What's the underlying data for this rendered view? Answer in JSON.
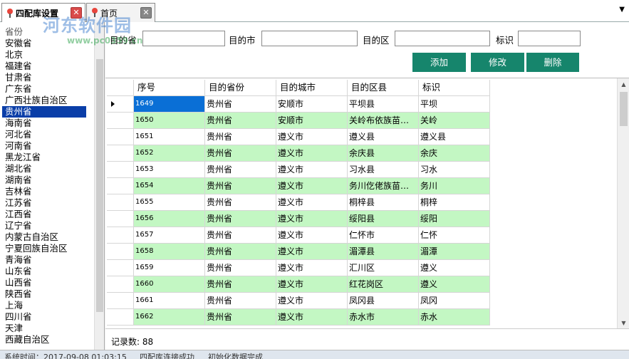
{
  "tabs": [
    {
      "label": "四配库设置",
      "active": true
    },
    {
      "label": "首页",
      "active": false
    }
  ],
  "watermark": {
    "title": "河东软件园",
    "url": "www.pc0359.cn"
  },
  "provinces": {
    "header": "省份",
    "selected": "贵州省",
    "items": [
      "安徽省",
      "北京",
      "福建省",
      "甘肃省",
      "广东省",
      "广西壮族自治区",
      "贵州省",
      "海南省",
      "河北省",
      "河南省",
      "黑龙江省",
      "湖北省",
      "湖南省",
      "吉林省",
      "江苏省",
      "江西省",
      "辽宁省",
      "内蒙古自治区",
      "宁夏回族自治区",
      "青海省",
      "山东省",
      "山西省",
      "陕西省",
      "上海",
      "四川省",
      "天津",
      "西藏自治区"
    ]
  },
  "filters": {
    "province_label": "目的省",
    "city_label": "目的市",
    "district_label": "目的区",
    "tag_label": "标识",
    "province_value": "",
    "city_value": "",
    "district_value": "",
    "tag_value": ""
  },
  "buttons": {
    "add": "添加",
    "edit": "修改",
    "delete": "删除"
  },
  "grid": {
    "columns": [
      "序号",
      "目的省份",
      "目的城市",
      "目的区县",
      "标识"
    ],
    "rows": [
      [
        "1649",
        "贵州省",
        "安顺市",
        "平坝县",
        "平坝"
      ],
      [
        "1650",
        "贵州省",
        "安顺市",
        "关岭布依族苗…",
        "关岭"
      ],
      [
        "1651",
        "贵州省",
        "遵义市",
        "遵义县",
        "遵义县"
      ],
      [
        "1652",
        "贵州省",
        "遵义市",
        "余庆县",
        "余庆"
      ],
      [
        "1653",
        "贵州省",
        "遵义市",
        "习水县",
        "习水"
      ],
      [
        "1654",
        "贵州省",
        "遵义市",
        "务川仡佬族苗…",
        "务川"
      ],
      [
        "1655",
        "贵州省",
        "遵义市",
        "桐梓县",
        "桐梓"
      ],
      [
        "1656",
        "贵州省",
        "遵义市",
        "绥阳县",
        "绥阳"
      ],
      [
        "1657",
        "贵州省",
        "遵义市",
        "仁怀市",
        "仁怀"
      ],
      [
        "1658",
        "贵州省",
        "遵义市",
        "湄潭县",
        "湄潭"
      ],
      [
        "1659",
        "贵州省",
        "遵义市",
        "汇川区",
        "遵义"
      ],
      [
        "1660",
        "贵州省",
        "遵义市",
        "红花岗区",
        "遵义"
      ],
      [
        "1661",
        "贵州省",
        "遵义市",
        "凤冈县",
        "凤冈"
      ],
      [
        "1662",
        "贵州省",
        "遵义市",
        "赤水市",
        "赤水"
      ]
    ],
    "current_row_marker": "▶",
    "selection_color": "#0a6fd6",
    "alt_row_color": "#c3f7c3"
  },
  "record_count": {
    "text": "记录数: 88"
  },
  "statusbar": {
    "time": "系统时间：2017-09-08 01:03:15",
    "conn": "四配库连接成功",
    "init": "初始化数据完成"
  },
  "colors": {
    "button_bg": "#16856c",
    "list_selected_bg": "#0a3ea8"
  }
}
